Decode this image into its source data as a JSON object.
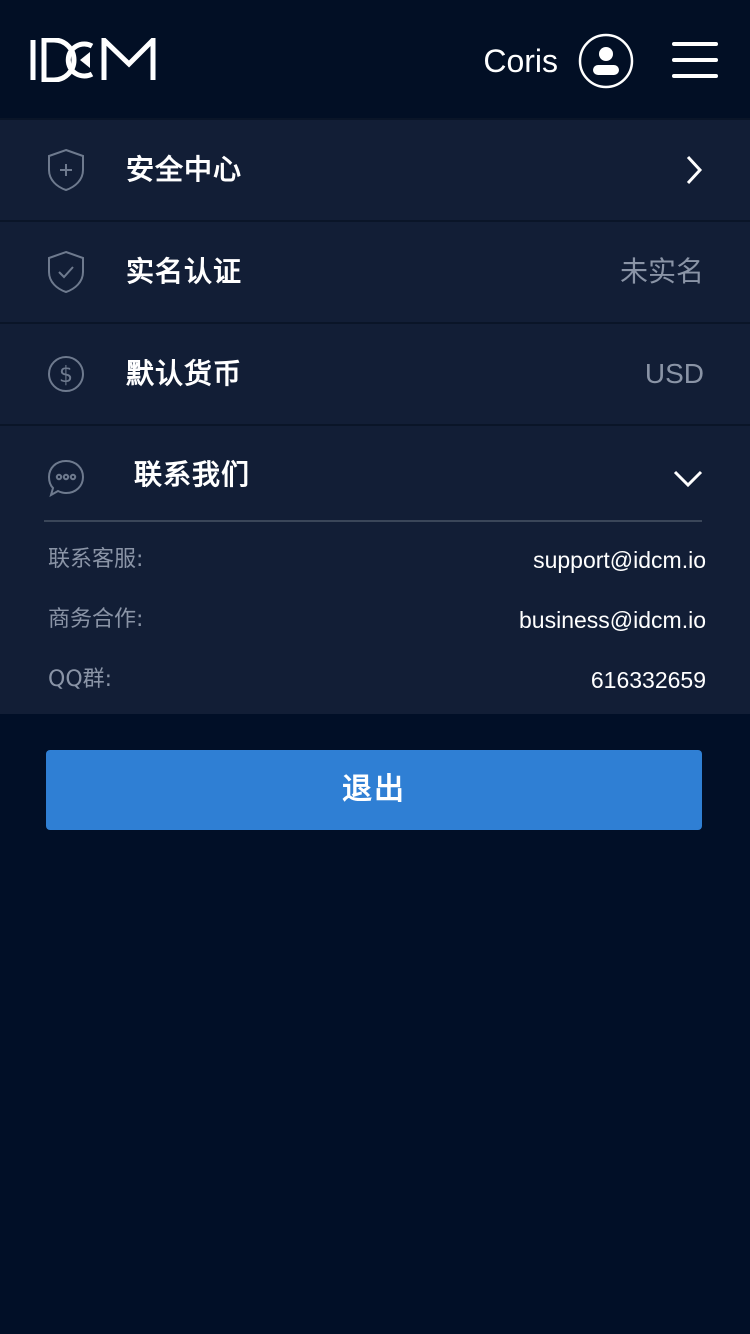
{
  "header": {
    "logo_text": "IDCM",
    "username": "Coris"
  },
  "menu": {
    "security": {
      "label": "安全中心",
      "icon": "shield-plus-icon"
    },
    "verification": {
      "label": "实名认证",
      "value": "未实名",
      "icon": "shield-check-icon"
    },
    "currency": {
      "label": "默认货币",
      "value": "USD",
      "icon": "dollar-circle-icon"
    },
    "contact": {
      "label": "联系我们",
      "icon": "chat-bubble-icon",
      "items": [
        {
          "key": "联系客服:",
          "value": "support@idcm.io"
        },
        {
          "key": "商务合作:",
          "value": "business@idcm.io"
        },
        {
          "key": "QQ群:",
          "value": "616332659"
        }
      ]
    }
  },
  "actions": {
    "logout_label": "退出"
  },
  "colors": {
    "background": "#010f27",
    "row_background": "#121e36",
    "accent": "#2f7fd4",
    "muted_text": "#8a94a6"
  }
}
